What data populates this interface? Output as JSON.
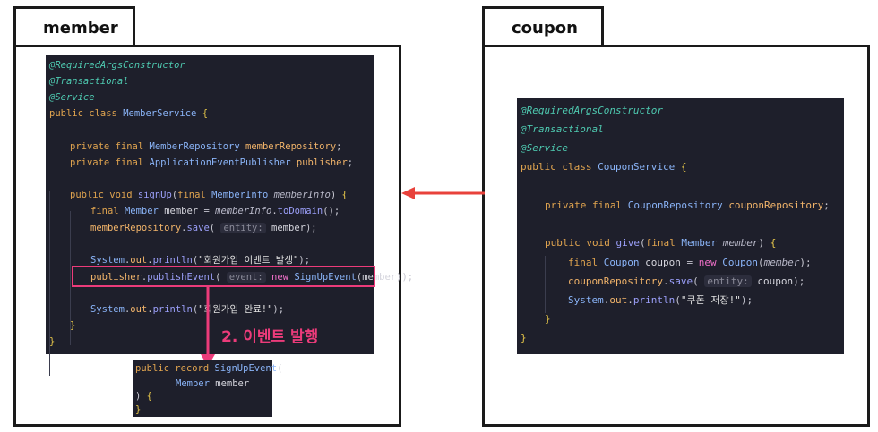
{
  "panels": {
    "member": {
      "title": "member"
    },
    "coupon": {
      "title": "coupon"
    }
  },
  "member_code": {
    "l1": "@RequiredArgsConstructor",
    "l2": "@Transactional",
    "l3": "@Service",
    "l4_kw": "public class",
    "l4_name": "MemberService",
    "l6_kw": "private final",
    "l6_type": "MemberRepository",
    "l6_field": "memberRepository",
    "l7_kw": "private final",
    "l7_type": "ApplicationEventPublisher",
    "l7_field": "publisher",
    "l9_kw": "public void",
    "l9_fn": "signUp",
    "l9_kw2": "final",
    "l9_type": "MemberInfo",
    "l9_param": "memberInfo",
    "l10_kw": "final",
    "l10_type": "Member",
    "l10_var": "member",
    "l10_src": "memberInfo",
    "l10_fn": "toDomain",
    "l11_field": "memberRepository",
    "l11_fn": "save",
    "l11_hint": "entity:",
    "l11_arg": "member",
    "l13_sys": "System",
    "l13_out": "out",
    "l13_fn": "println",
    "l13_str": "\"회원가입 이벤트 발생\"",
    "l14_field": "publisher",
    "l14_fn": "publishEvent",
    "l14_hint": "event:",
    "l14_new": "new",
    "l14_type": "SignUpEvent",
    "l14_arg": "member",
    "l16_sys": "System",
    "l16_out": "out",
    "l16_fn": "println",
    "l16_str": "\"회원가입 완료!\""
  },
  "event_code": {
    "l1_kw": "public record",
    "l1_name": "SignUpEvent",
    "l2_type": "Member",
    "l2_field": "member"
  },
  "coupon_code": {
    "l1": "@RequiredArgsConstructor",
    "l2": "@Transactional",
    "l3": "@Service",
    "l4_kw": "public class",
    "l4_name": "CouponService",
    "l6_kw": "private final",
    "l6_type": "CouponRepository",
    "l6_field": "couponRepository",
    "l8_kw": "public void",
    "l8_fn": "give",
    "l8_kw2": "final",
    "l8_type": "Member",
    "l8_param": "member",
    "l9_kw": "final",
    "l9_type": "Coupon",
    "l9_var": "coupon",
    "l9_new": "new",
    "l9_ctor": "Coupon",
    "l9_arg": "member",
    "l10_field": "couponRepository",
    "l10_fn": "save",
    "l10_hint": "entity:",
    "l10_arg": "coupon",
    "l11_sys": "System",
    "l11_out": "out",
    "l11_fn": "println",
    "l11_str": "\"쿠폰 저장!\""
  },
  "annotation": {
    "label": "2. 이벤트 발행"
  },
  "colors": {
    "accent": "#ec3b7a",
    "arrow": "#e8413b",
    "code_bg": "#1e1f2b"
  }
}
